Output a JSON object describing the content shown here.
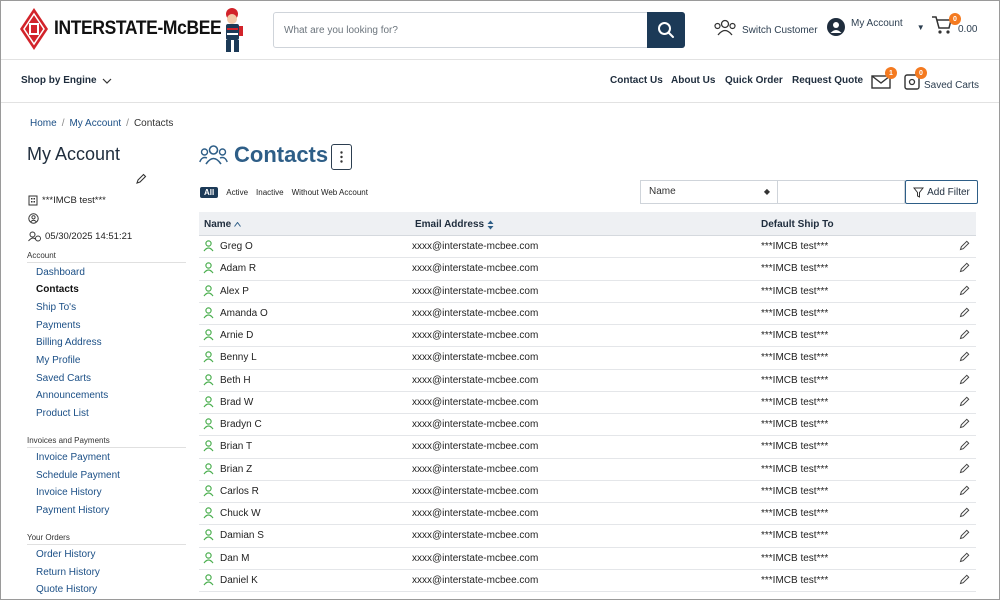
{
  "brand": {
    "name": "INTERSTATE-McBEE"
  },
  "search": {
    "placeholder": "What are you looking for?"
  },
  "header": {
    "switch_customer": "Switch Customer",
    "my_account": "My Account",
    "cart_count": "0",
    "cart_total": "0.00"
  },
  "nav": {
    "shop_by_engine": "Shop by Engine",
    "links": [
      "Contact Us",
      "About Us",
      "Quick Order",
      "Request Quote"
    ],
    "messages_count": "1",
    "saved_carts_count": "0",
    "saved_carts": "Saved Carts"
  },
  "breadcrumb": [
    "Home",
    "My Account",
    "Contacts"
  ],
  "sidebar": {
    "title": "My Account",
    "customer": "***IMCB test***",
    "timestamp": "05/30/2025 14:51:21",
    "sections": [
      {
        "title": "Account",
        "items": [
          "Dashboard",
          "Contacts",
          "Ship To's",
          "Payments",
          "Billing Address",
          "My Profile",
          "Saved Carts",
          "Announcements",
          "Product List"
        ]
      },
      {
        "title": "Invoices and Payments",
        "items": [
          "Invoice Payment",
          "Schedule Payment",
          "Invoice History",
          "Payment History"
        ]
      },
      {
        "title": "Your Orders",
        "items": [
          "Order History",
          "Return History",
          "Quote History"
        ]
      }
    ],
    "active_item": "Contacts"
  },
  "page": {
    "title": "Contacts",
    "filters": [
      "All",
      "Active",
      "Inactive",
      "Without Web Account"
    ],
    "active_filter": "All",
    "filter_field": "Name",
    "add_filter": "Add Filter"
  },
  "table": {
    "headers": [
      "Name",
      "Email Address",
      "Default Ship To"
    ],
    "rows": [
      [
        "Greg O",
        "xxxx@interstate-mcbee.com",
        "***IMCB test***"
      ],
      [
        "Adam R",
        "xxxx@interstate-mcbee.com",
        "***IMCB test***"
      ],
      [
        "Alex P",
        "xxxx@interstate-mcbee.com",
        "***IMCB test***"
      ],
      [
        "Amanda O",
        "xxxx@interstate-mcbee.com",
        "***IMCB test***"
      ],
      [
        "Arnie D",
        "xxxx@interstate-mcbee.com",
        "***IMCB test***"
      ],
      [
        "Benny L",
        "xxxx@interstate-mcbee.com",
        "***IMCB test***"
      ],
      [
        "Beth H",
        "xxxx@interstate-mcbee.com",
        "***IMCB test***"
      ],
      [
        "Brad W",
        "xxxx@interstate-mcbee.com",
        "***IMCB test***"
      ],
      [
        "Bradyn C",
        "xxxx@interstate-mcbee.com",
        "***IMCB test***"
      ],
      [
        "Brian T",
        "xxxx@interstate-mcbee.com",
        "***IMCB test***"
      ],
      [
        "Brian Z",
        "xxxx@interstate-mcbee.com",
        "***IMCB test***"
      ],
      [
        "Carlos R",
        "xxxx@interstate-mcbee.com",
        "***IMCB test***"
      ],
      [
        "Chuck W",
        "xxxx@interstate-mcbee.com",
        "***IMCB test***"
      ],
      [
        "Damian S",
        "xxxx@interstate-mcbee.com",
        "***IMCB test***"
      ],
      [
        "Dan M",
        "xxxx@interstate-mcbee.com",
        "***IMCB test***"
      ],
      [
        "Daniel K",
        "xxxx@interstate-mcbee.com",
        "***IMCB test***"
      ]
    ]
  },
  "colors": {
    "primary": "#1c3a57",
    "accent": "#f47a20",
    "title": "#2e5e87",
    "link": "#1b4f86",
    "logo_red": "#d2232a",
    "user_icon": "#4caf50"
  }
}
